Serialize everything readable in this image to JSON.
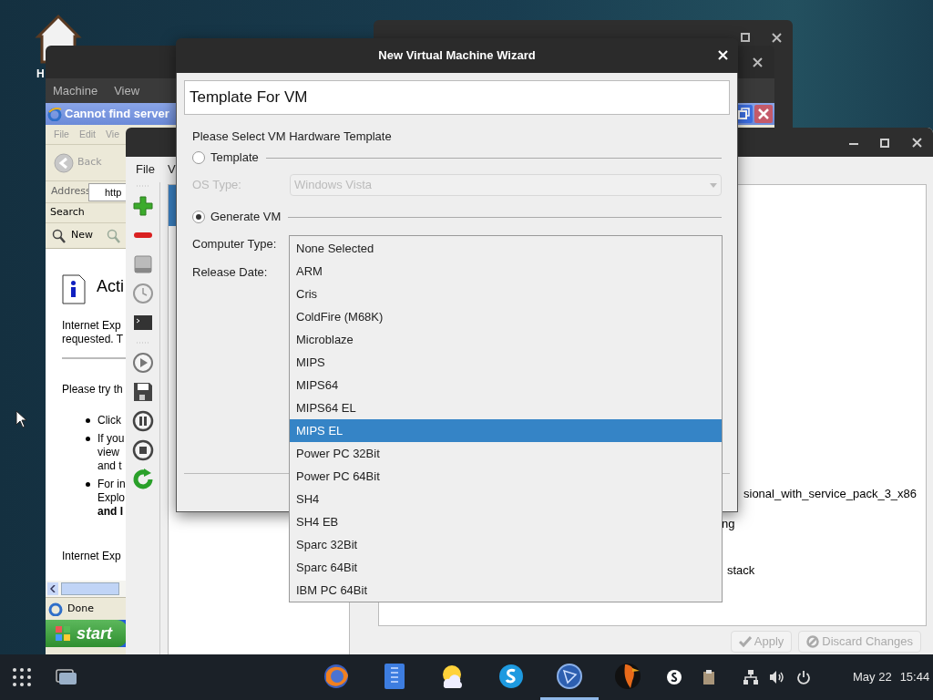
{
  "desktop": {
    "icon_label": "H"
  },
  "vm_window": {
    "menu": [
      "Machine",
      "View"
    ]
  },
  "browser_window": {
    "title": "Cannot find server",
    "menu": [
      "File",
      "Edit",
      "Vie"
    ],
    "back": "Back",
    "address_label": "Address",
    "address_value": "http",
    "search_label": "Search",
    "new_label": "New",
    "heading": "Acti",
    "intro": "Internet Exp\nrequested. T",
    "prompt": "Please try th",
    "bullets": [
      "Click",
      "If you\nview\nand t",
      "For in\nExplo\n**and I**"
    ],
    "footer": "Internet Exp",
    "status": "Done",
    "start": "start"
  },
  "manager_window": {
    "menu": [
      "File",
      "V"
    ],
    "detail_fragments": [
      "sional_with_service_pack_3_x86",
      "ng",
      "stack"
    ],
    "buttons": [
      {
        "label": "Apply",
        "kind": "apply",
        "disabled": true
      },
      {
        "label": "Discard Changes",
        "kind": "discard",
        "disabled": true
      }
    ]
  },
  "wizard": {
    "title": "New Virtual Machine Wizard",
    "name_value": "Template For VM",
    "prompt": "Please Select VM Hardware Template",
    "options": [
      {
        "label": "Template",
        "selected": false
      },
      {
        "label": "Generate VM",
        "selected": true
      }
    ],
    "os_type": {
      "label": "OS Type:",
      "value": "Windows Vista",
      "disabled": true
    },
    "computer_type_label": "Computer Type:",
    "release_date_label": "Release Date:"
  },
  "dropdown": {
    "items": [
      {
        "label": "None Selected",
        "selected": false
      },
      {
        "label": "ARM",
        "selected": false
      },
      {
        "label": "Cris",
        "selected": false
      },
      {
        "label": "ColdFire (M68K)",
        "selected": false
      },
      {
        "label": "Microblaze",
        "selected": false
      },
      {
        "label": "MIPS",
        "selected": false
      },
      {
        "label": "MIPS64",
        "selected": false
      },
      {
        "label": "MIPS64 EL",
        "selected": false
      },
      {
        "label": "MIPS EL",
        "selected": true
      },
      {
        "label": "Power PC 32Bit",
        "selected": false
      },
      {
        "label": "Power PC 64Bit",
        "selected": false
      },
      {
        "label": "SH4",
        "selected": false
      },
      {
        "label": "SH4 EB",
        "selected": false
      },
      {
        "label": "Sparc 32Bit",
        "selected": false
      },
      {
        "label": "Sparc 64Bit",
        "selected": false
      },
      {
        "label": "IBM PC 64Bit",
        "selected": false
      }
    ]
  },
  "taskbar": {
    "apps": [
      {
        "kind": "globe",
        "selected": false
      },
      {
        "kind": "document",
        "selected": false
      },
      {
        "kind": "weather",
        "selected": false
      },
      {
        "kind": "chat",
        "selected": false
      },
      {
        "kind": "compass",
        "selected": true
      },
      {
        "kind": "bird",
        "selected": false
      }
    ],
    "date": "May 22",
    "time": "15:44"
  }
}
